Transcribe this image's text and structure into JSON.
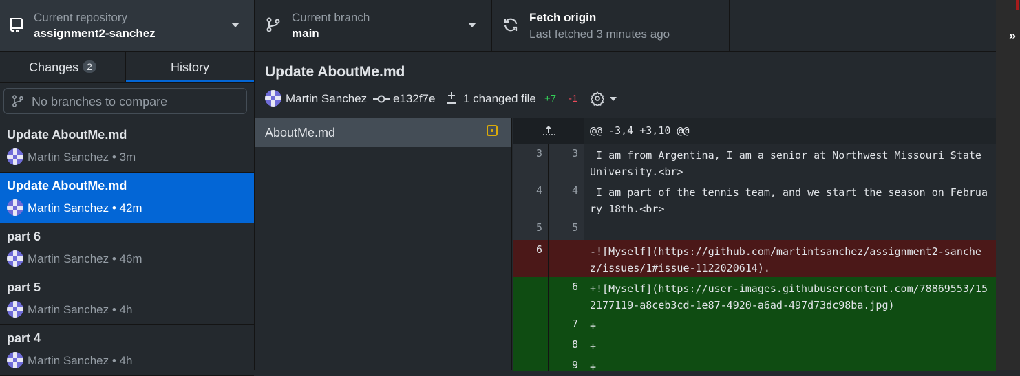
{
  "toolbar": {
    "repo": {
      "label": "Current repository",
      "value": "assignment2-sanchez"
    },
    "branch": {
      "label": "Current branch",
      "value": "main"
    },
    "fetch": {
      "title": "Fetch origin",
      "subtitle": "Last fetched 3 minutes ago"
    },
    "right_chevron": "»"
  },
  "sidebar": {
    "tabs": [
      {
        "label": "Changes",
        "badge": "2"
      },
      {
        "label": "History"
      }
    ],
    "compare_placeholder": "No branches to compare",
    "commits": [
      {
        "title": "Update AboutMe.md",
        "meta": "Martin Sanchez • 3m"
      },
      {
        "title": "Update AboutMe.md",
        "meta": "Martin Sanchez • 42m",
        "selected": true
      },
      {
        "title": "part 6",
        "meta": "Martin Sanchez • 46m"
      },
      {
        "title": "part 5",
        "meta": "Martin Sanchez • 4h"
      },
      {
        "title": "part 4",
        "meta": "Martin Sanchez • 4h"
      }
    ]
  },
  "commit": {
    "title": "Update AboutMe.md",
    "author": "Martin Sanchez",
    "sha": "e132f7e",
    "files_changed": "1 changed file",
    "additions": "+7",
    "deletions": "-1"
  },
  "files": [
    {
      "name": "AboutMe.md",
      "status": "modified"
    }
  ],
  "diff": {
    "hunk_header": "@@ -3,4 +3,10 @@",
    "lines": [
      {
        "type": "ctx",
        "old": "3",
        "new": "3",
        "text": " I am from Argentina, I am a senior at Northwest Missouri State University.<br>"
      },
      {
        "type": "ctx",
        "old": "4",
        "new": "4",
        "text": " I am part of the tennis team, and we start the season on February 18th.<br>"
      },
      {
        "type": "ctx",
        "old": "5",
        "new": "5",
        "text": " "
      },
      {
        "type": "del",
        "old": "6",
        "new": "",
        "text": "-![Myself](https://github.com/martintsanchez/assignment2-sanchez/issues/1#issue-1122020614)."
      },
      {
        "type": "add",
        "old": "",
        "new": "6",
        "text": "+![Myself](https://user-images.githubusercontent.com/78869553/152177119-a8ceb3cd-1e87-4920-a6ad-497d73dc98ba.jpg)"
      },
      {
        "type": "add",
        "old": "",
        "new": "7",
        "text": "+"
      },
      {
        "type": "add",
        "old": "",
        "new": "8",
        "text": "+"
      },
      {
        "type": "add",
        "old": "",
        "new": "9",
        "text": "+"
      }
    ]
  },
  "colors": {
    "accent": "#0366d6",
    "added": "#34d058",
    "deleted": "#ea4a5a",
    "modified": "#dbab09"
  }
}
